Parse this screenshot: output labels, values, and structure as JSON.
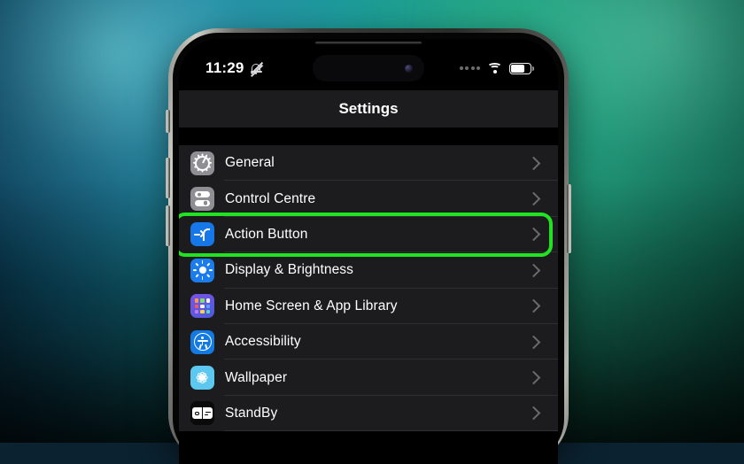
{
  "wallpaper": {
    "left_color": "#0d4f75",
    "mid_color": "#1b9b99",
    "right_color": "#1e9a78"
  },
  "device": {
    "name": "iPhone",
    "frame_color": "#3a3a38"
  },
  "status_bar": {
    "time": "11:29",
    "silent_icon": "bell-slash-icon",
    "signal_icon": "cellular-dots-icon",
    "wifi_icon": "wifi-icon",
    "battery_icon": "battery-icon"
  },
  "dynamic_island": {
    "camera_icon": "front-camera-icon"
  },
  "nav": {
    "title": "Settings"
  },
  "highlight": {
    "color": "#22e322",
    "target": "Action Button"
  },
  "settings": {
    "items": [
      {
        "label": "General",
        "icon": "gear-icon",
        "icon_bg": "#8e8e93",
        "highlighted": false
      },
      {
        "label": "Control Centre",
        "icon": "sliders-icon",
        "icon_bg": "#8e8e93",
        "highlighted": false
      },
      {
        "label": "Action Button",
        "icon": "action-button-icon",
        "icon_bg": "#1577e8",
        "highlighted": true
      },
      {
        "label": "Display & Brightness",
        "icon": "brightness-icon",
        "icon_bg": "#1b7ced",
        "highlighted": false
      },
      {
        "label": "Home Screen & App Library",
        "icon": "app-grid-icon",
        "icon_bg": "#6a4ee0",
        "highlighted": false
      },
      {
        "label": "Accessibility",
        "icon": "accessibility-icon",
        "icon_bg": "#147ae3",
        "highlighted": false
      },
      {
        "label": "Wallpaper",
        "icon": "flower-icon",
        "icon_bg": "#5cc7ef",
        "highlighted": false
      },
      {
        "label": "StandBy",
        "icon": "standby-icon",
        "icon_bg": "#0a0a0a",
        "highlighted": false
      }
    ],
    "chevron_icon": "chevron-right-icon"
  }
}
